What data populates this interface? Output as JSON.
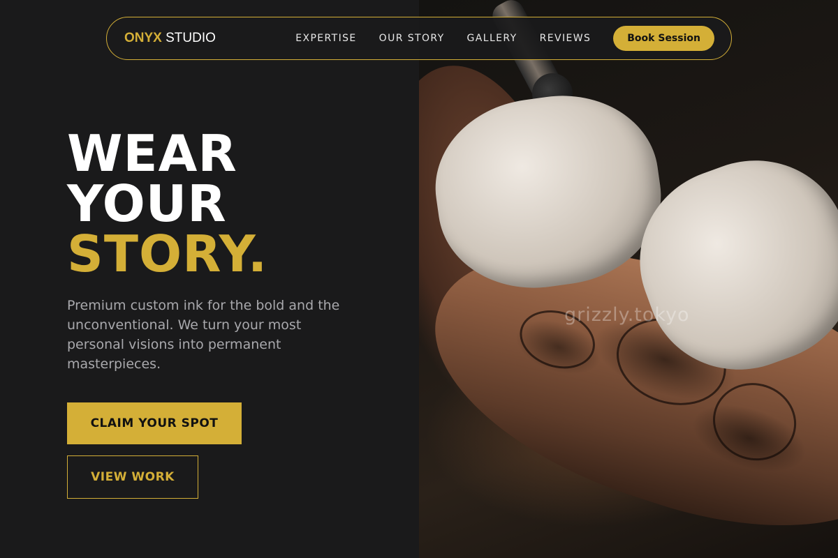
{
  "brand": {
    "accent_part": "ONYX",
    "rest_part": " STUDIO",
    "accent_color": "#d4af37"
  },
  "nav": {
    "links": [
      "EXPERTISE",
      "OUR STORY",
      "GALLERY",
      "REVIEWS"
    ],
    "book_label": "Book Session"
  },
  "hero": {
    "title_line1": "WEAR",
    "title_line2": "YOUR",
    "title_line3": "STORY.",
    "subtitle": "Premium custom ink for the bold and the unconventional. We turn your most personal visions into permanent masterpieces.",
    "primary_cta": "CLAIM YOUR SPOT",
    "secondary_cta": "VIEW WORK"
  },
  "photo": {
    "watermark": "grizzly.tokyo"
  },
  "colors": {
    "background": "#1a1a1b",
    "gold": "#d4af37",
    "text_muted": "#a9a9ad"
  }
}
